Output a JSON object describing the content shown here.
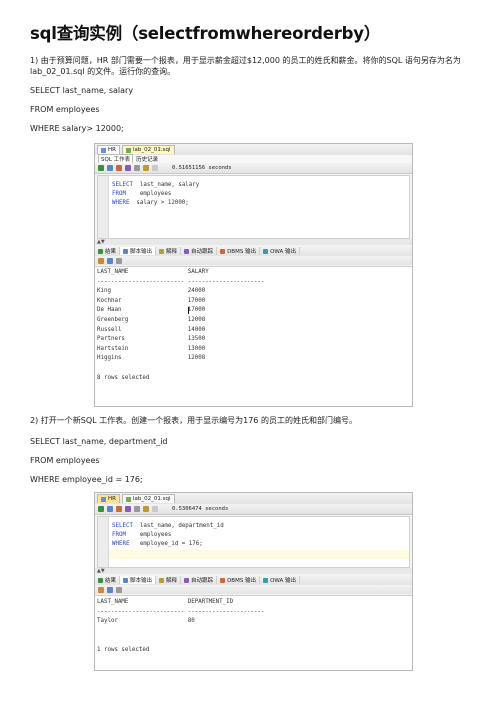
{
  "title": "sql查询实例（selectfromwhereorderby）",
  "section1": {
    "intro": "1) 由于预算问题，HR 部门需要一个报表，用于显示薪金超过$12,000 的员工的姓氏和薪金。将你的SQL 语句另存为名为 lab_02_01.sql 的文件。运行你的查询。",
    "sql": [
      "SELECT last_name, salary",
      "FROM employees",
      "WHERE salary> 12000;"
    ]
  },
  "screenshot1": {
    "tabs": [
      "HR",
      "lab_02_01.sql"
    ],
    "subtabs": [
      "SQL 工作表",
      "历史记录"
    ],
    "timing": "0.51651156 seconds",
    "code": [
      {
        "kw": "SELECT",
        "rest": "  last_name, salary"
      },
      {
        "kw": "FROM",
        "rest": "    employees"
      },
      {
        "kw": "WHERE",
        "rest": "  salary > 12000;"
      }
    ],
    "result_tabs": [
      "结果",
      "脚本输出",
      "解释",
      "自动跟踪",
      "DBMS 输出",
      "OWA 输出"
    ],
    "header": "LAST_NAME                 SALARY",
    "rule": "------------------------- ----------------------",
    "rows": [
      "King                      24000",
      "Kochhar                   17000",
      "De Haan                   17000",
      "Greenberg                 12008",
      "Russell                   14000",
      "Partners                  13500",
      "Hartstein                 13000",
      "Higgins                   12008"
    ],
    "footer": "8 rows selected"
  },
  "section2": {
    "intro": "2) 打开一个新SQL 工作表。创建一个报表，用于显示编号为176 的员工的姓氏和部门编号。",
    "sql": [
      "SELECT last_name, department_id",
      "FROM employees",
      "WHERE employee_id = 176;"
    ]
  },
  "screenshot2": {
    "tabs": [
      "HR",
      "lab_02_01.sql"
    ],
    "timing": "0.5306474 seconds",
    "code": [
      {
        "kw": "SELECT",
        "rest": "  last_name, department_id"
      },
      {
        "kw": "FROM",
        "rest": "    employees"
      },
      {
        "kw": "WHERE",
        "rest": "   employee_id = 176;"
      }
    ],
    "result_tabs": [
      "结果",
      "脚本输出",
      "解释",
      "自动跟踪",
      "DBMS 输出",
      "OWA 输出"
    ],
    "header": "LAST_NAME                 DEPARTMENT_ID",
    "rule": "------------------------- ----------------------",
    "rows": [
      "Taylor                    80"
    ],
    "footer": "1 rows selected"
  }
}
